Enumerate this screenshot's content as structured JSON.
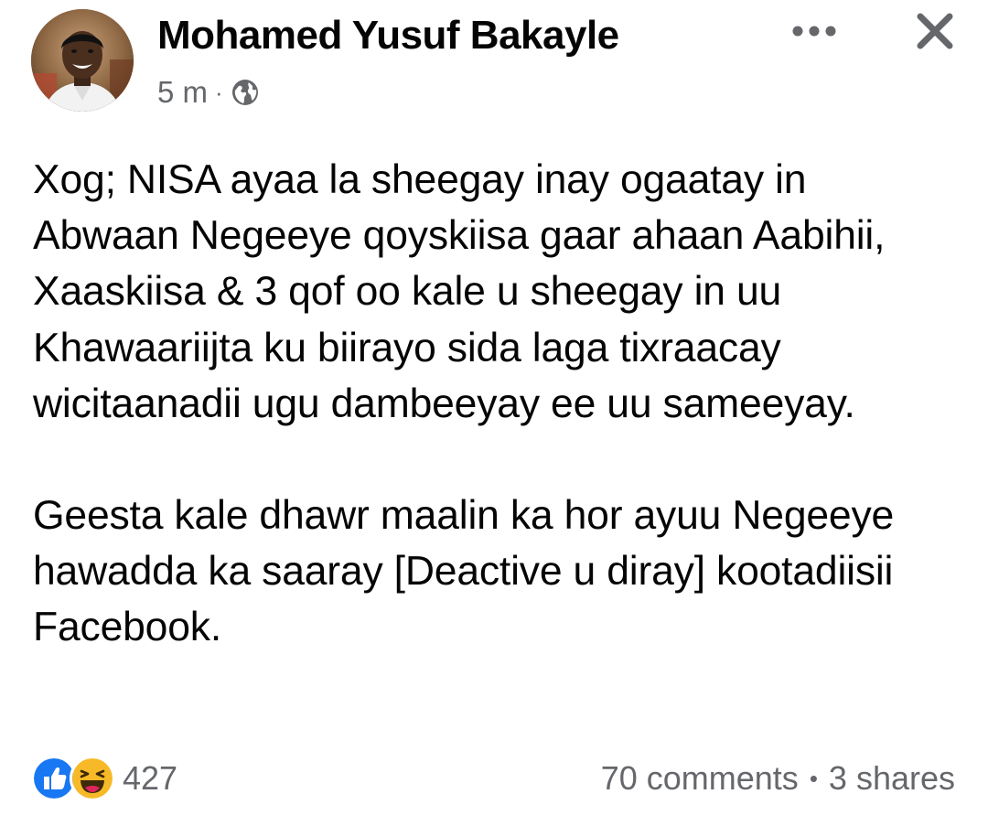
{
  "post": {
    "author": {
      "name": "Mohamed Yusuf Bakayle"
    },
    "meta": {
      "time": "5 m",
      "separator": "·",
      "audience_icon": "globe-icon"
    },
    "actions": {
      "more_icon": "more-horizontal-icon",
      "close_icon": "close-icon"
    },
    "paragraphs": [
      "Xog; NISA ayaa la sheegay inay ogaatay in Abwaan Negeeye qoyskiisa gaar ahaan Aabihii, Xaaskiisa & 3 qof oo kale u sheegay in uu Khawaariijta ku biirayo sida laga tixraacay wicitaanadii ugu dambeeyay ee uu sameeyay.",
      "Geesta kale dhawr maalin ka hor ayuu Negeeye hawadda ka saaray [Deactive u diray] kootadiisii Facebook."
    ],
    "footer": {
      "reaction_icons": [
        "like-icon",
        "haha-icon"
      ],
      "reaction_count": "427",
      "comments": "70 comments",
      "separator": "•",
      "shares": "3 shares"
    }
  },
  "colors": {
    "text_primary": "#050505",
    "text_secondary": "#65676b",
    "like_blue": "#1877f2",
    "haha_yellow": "#f7b928"
  }
}
